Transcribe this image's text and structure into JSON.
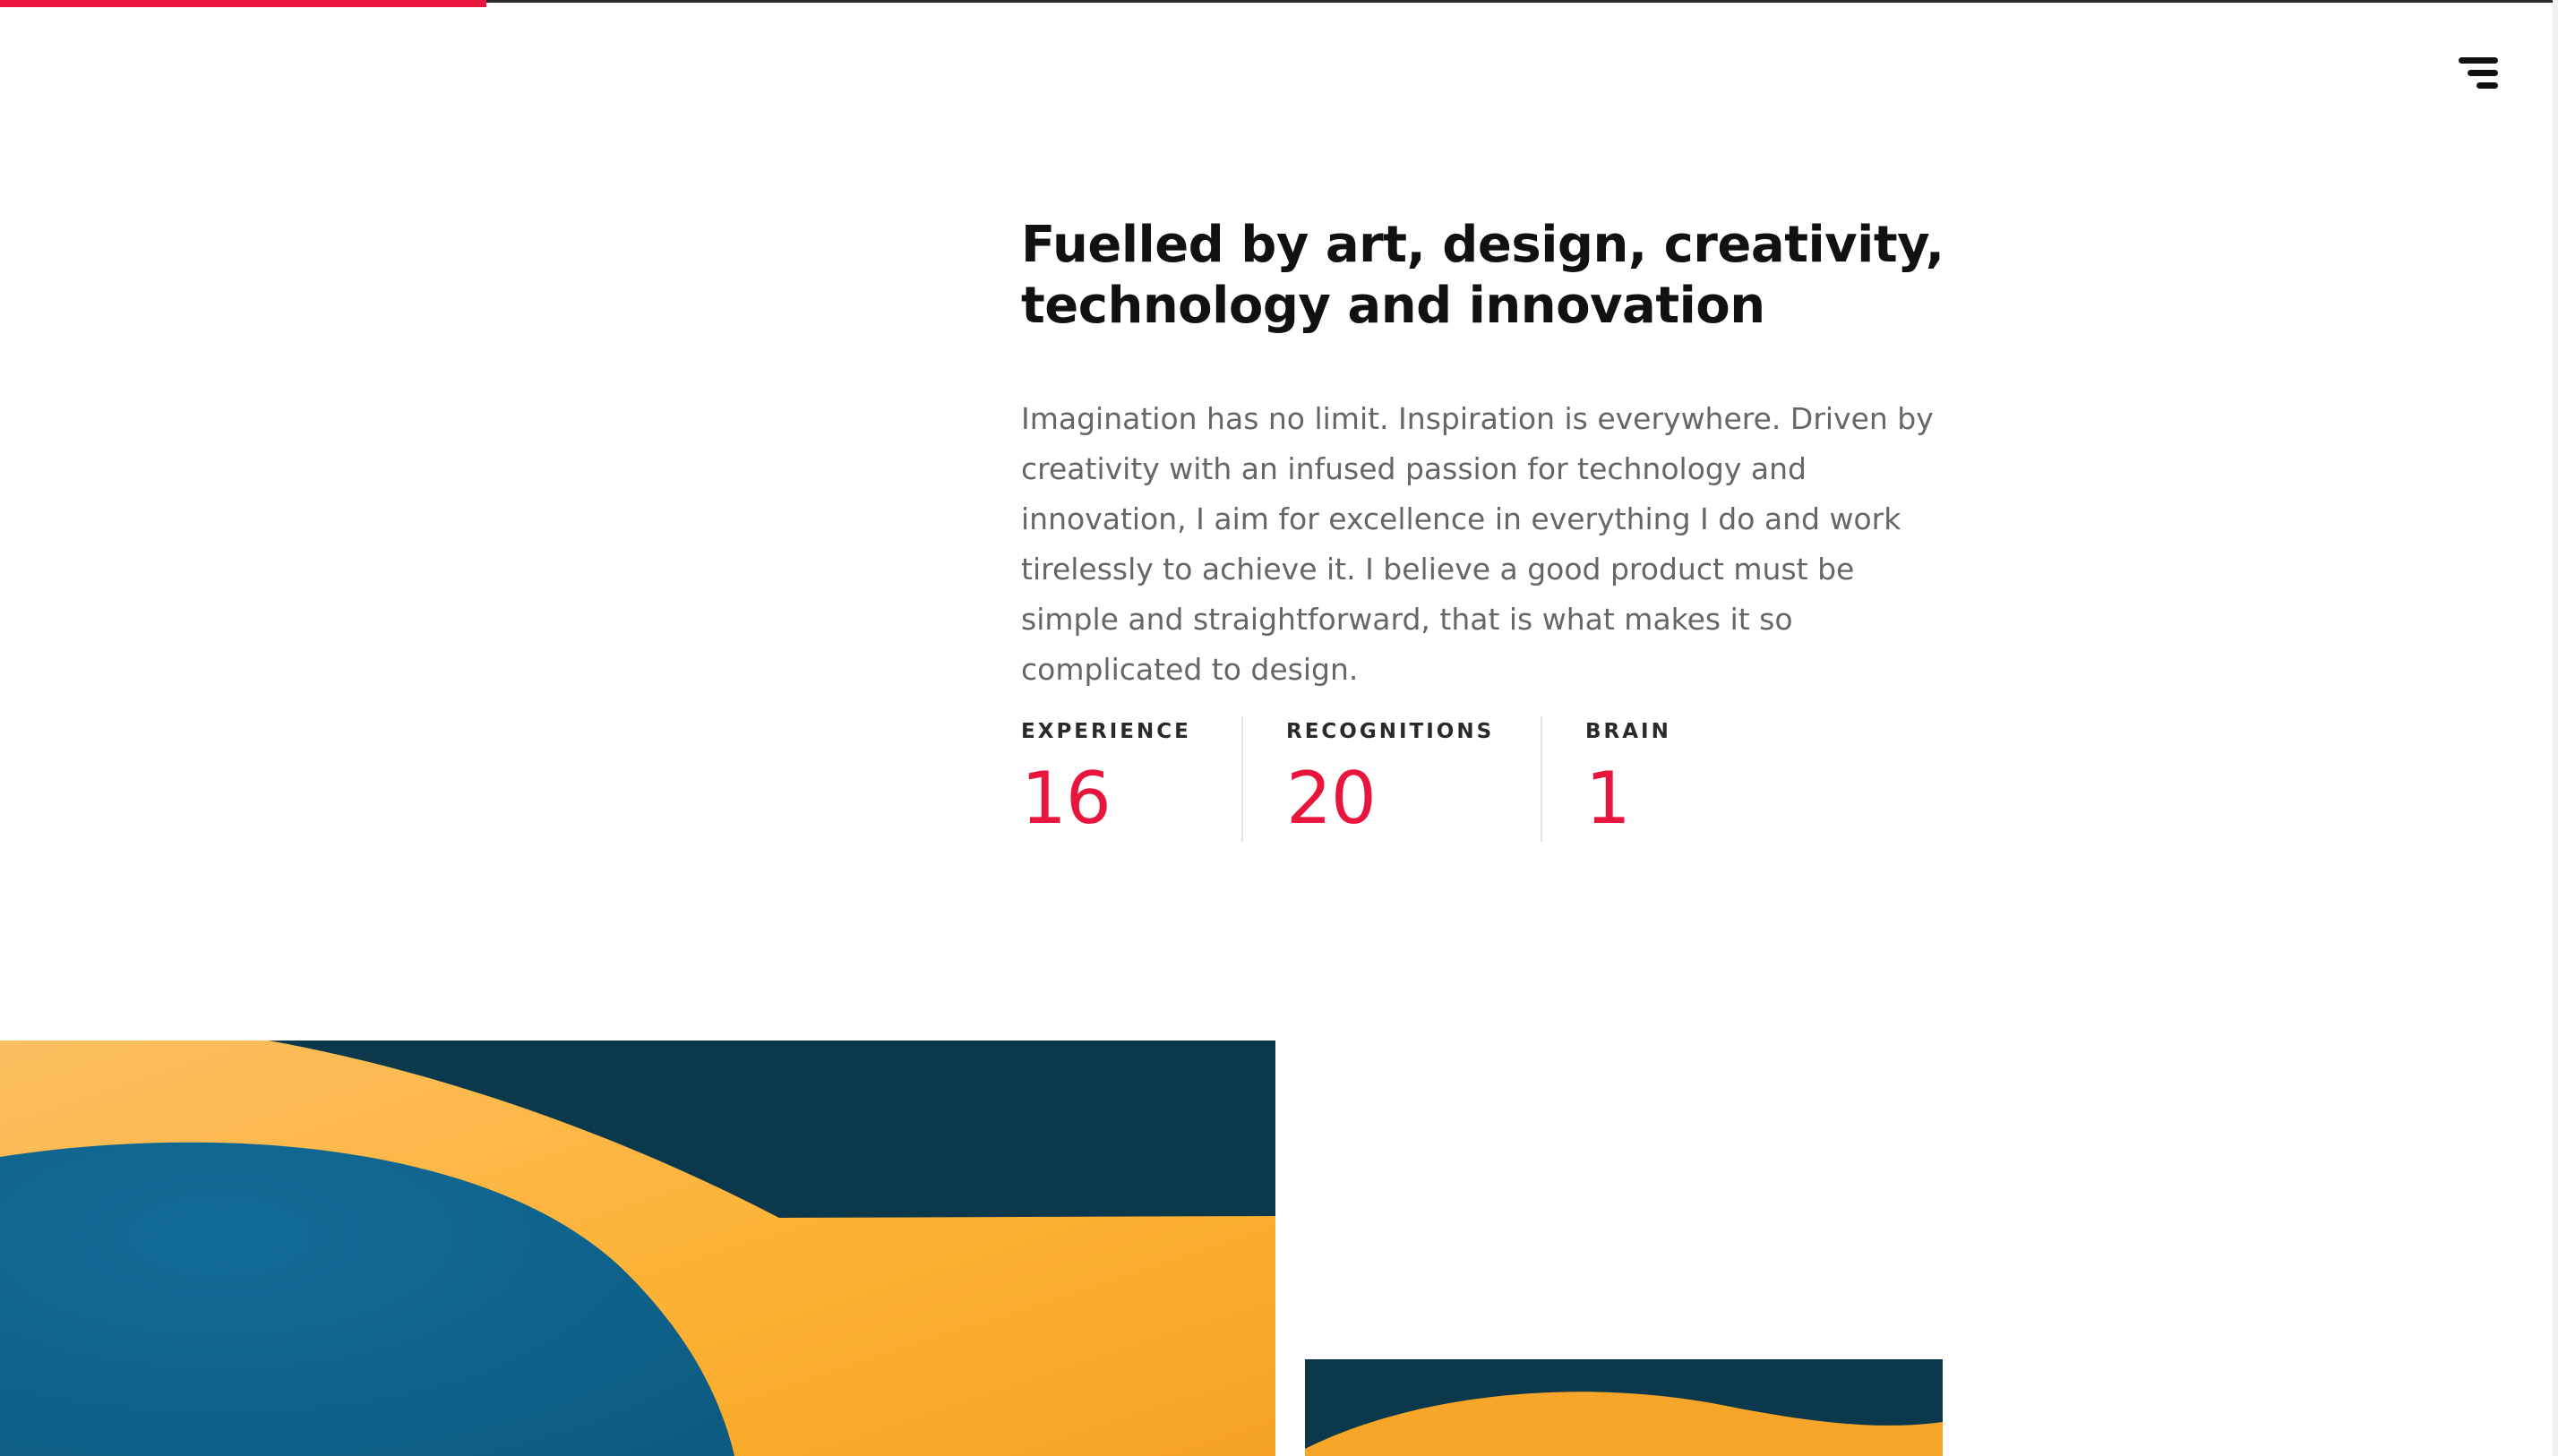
{
  "header": {
    "progress": 0.19,
    "menu_icon": "hamburger-menu-icon"
  },
  "about": {
    "headline": "Fuelled by art, design, creativity,\ntechnology and innovation",
    "paragraph": "Imagination has no limit. Inspiration is everywhere. Driven by creativity with an infused passion for technology and innovation, I aim for excellence in everything I do and work tirelessly to achieve it. I believe a good product must be simple and straightforward, that is what makes it so complicated to design."
  },
  "stats": [
    {
      "label": "EXPERIENCE",
      "value": "16"
    },
    {
      "label": "RECOGNITIONS",
      "value": "20"
    },
    {
      "label": "BRAIN",
      "value": "1"
    }
  ],
  "colors": {
    "accent": "#e8163c",
    "navy": "#0c384c",
    "blue": "#0f6a95",
    "orange": "#fbb03b",
    "text_dark": "#111111",
    "text_muted": "#666666"
  }
}
